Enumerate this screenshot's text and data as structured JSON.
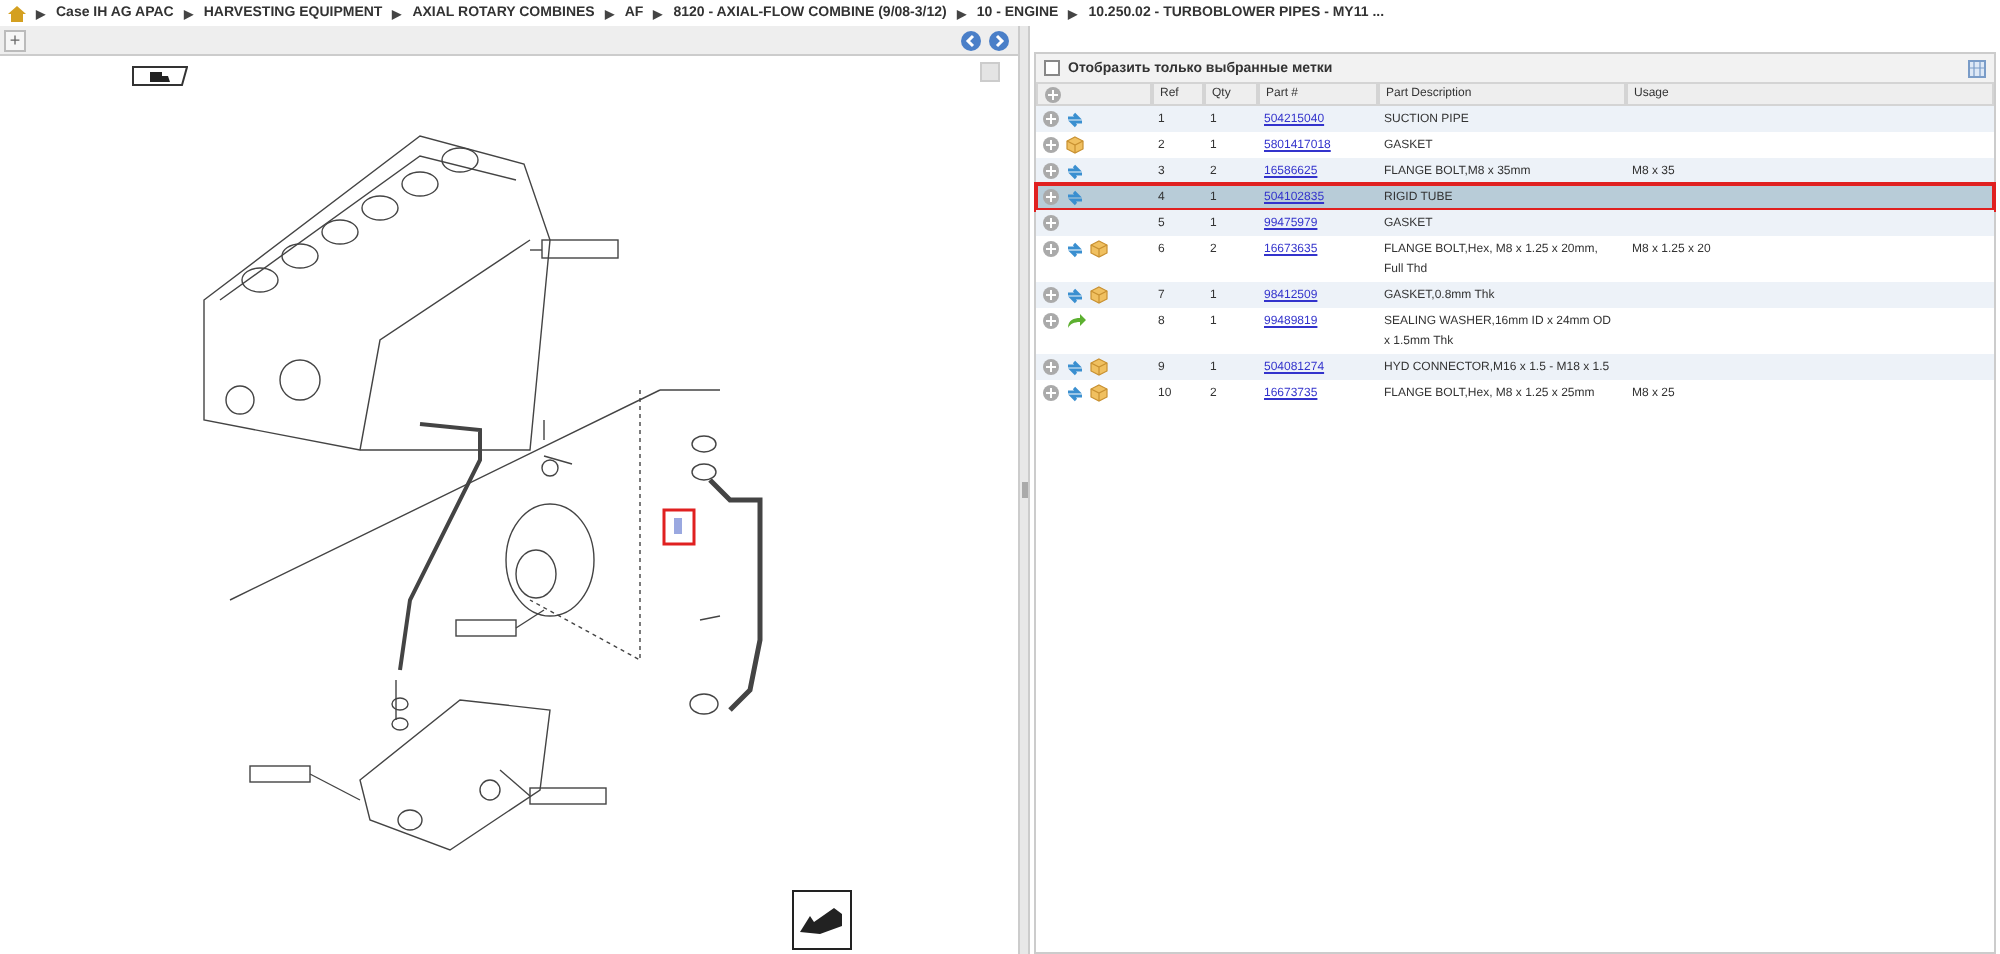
{
  "breadcrumb": {
    "separator": "▶",
    "items": [
      "Case IH AG APAC",
      "HARVESTING EQUIPMENT",
      "AXIAL ROTARY COMBINES",
      "AF",
      "8120 - AXIAL-FLOW COMBINE (9/08-3/12)",
      "10 - ENGINE",
      "10.250.02 - TURBOBLOWER PIPES - MY11 ..."
    ]
  },
  "left_toolbar": {
    "expand": "+"
  },
  "filter": {
    "label": "Отобразить только выбранные метки",
    "checked": false
  },
  "table": {
    "columns": [
      "Ref",
      "Qty",
      "Part #",
      "Part Description",
      "Usage"
    ],
    "rows": [
      {
        "icons": [
          {
            "kind": "swap"
          }
        ],
        "ref": "1",
        "qty": "1",
        "part": "504215040",
        "description": "SUCTION PIPE",
        "selected": false
      },
      {
        "icons": [
          {
            "kind": "box"
          }
        ],
        "ref": "2",
        "qty": "1",
        "part": "5801417018",
        "description": "GASKET",
        "selected": false
      },
      {
        "icons": [
          {
            "kind": "swap"
          }
        ],
        "ref": "3",
        "qty": "2",
        "part": "16586625",
        "description": "FLANGE BOLT,M8 x 35mm",
        "usage": "M8 x 35",
        "selected": false
      },
      {
        "icons": [
          {
            "kind": "swap"
          }
        ],
        "ref": "4",
        "qty": "1",
        "part": "504102835",
        "description": "RIGID TUBE",
        "selected": true
      },
      {
        "icons": [],
        "ref": "5",
        "qty": "1",
        "part": "99475979",
        "description": "GASKET",
        "selected": false
      },
      {
        "icons": [
          {
            "kind": "swap"
          },
          {
            "kind": "box"
          }
        ],
        "ref": "6",
        "qty": "2",
        "part": "16673635",
        "description": "FLANGE BOLT,Hex, M8 x 1.25 x 20mm, Full Thd",
        "usage": "M8 x 1.25 x 20",
        "selected": false
      },
      {
        "icons": [
          {
            "kind": "swap"
          },
          {
            "kind": "box"
          }
        ],
        "ref": "7",
        "qty": "1",
        "part": "98412509",
        "description": "GASKET,0.8mm Thk",
        "selected": false
      },
      {
        "icons": [
          {
            "kind": "forward"
          }
        ],
        "ref": "8",
        "qty": "1",
        "part": "99489819",
        "description": "SEALING WASHER,16mm ID x 24mm OD x 1.5mm Thk",
        "selected": false
      },
      {
        "icons": [
          {
            "kind": "swap"
          },
          {
            "kind": "box"
          }
        ],
        "ref": "9",
        "qty": "1",
        "part": "504081274",
        "description": "HYD CONNECTOR,M16 x 1.5 - M18 x 1.5",
        "selected": false
      },
      {
        "icons": [
          {
            "kind": "swap"
          },
          {
            "kind": "box"
          }
        ],
        "ref": "10",
        "qty": "2",
        "part": "16673735",
        "description": "FLANGE BOLT,Hex, M8 x 1.25 x 25mm",
        "usage": "M8 x 25",
        "selected": false
      }
    ]
  }
}
